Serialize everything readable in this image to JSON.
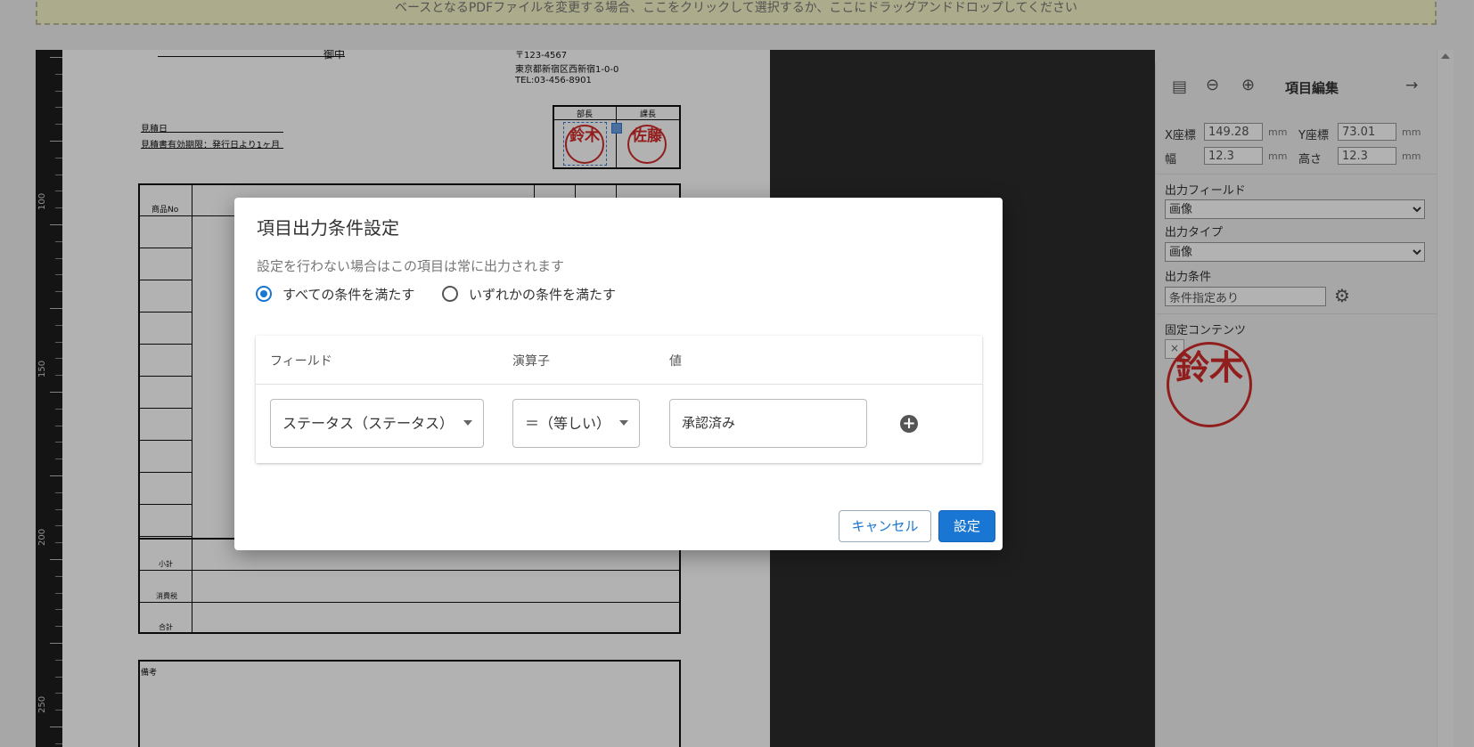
{
  "banner": {
    "text": "ベースとなるPDFファイルを変更する場合、ここをクリックして選択するか、ここにドラッグアンドドロップしてください"
  },
  "ruler": {
    "labels": [
      "100",
      "150",
      "200",
      "250"
    ]
  },
  "document": {
    "goten": "御中",
    "postal": "〒123-4567",
    "address": "東京都新宿区西新宿1-0-0",
    "tel": "TEL:03-456-8901",
    "estimate_date": "見積日",
    "validity": "見積書有効期限：発行日より1ヶ月",
    "approver1": "部長",
    "approver2": "課長",
    "stamp1": "鈴木",
    "stamp2": "佐藤",
    "col_item_no": "商品No",
    "subtotal": "小計",
    "tax": "消費税",
    "total": "合計",
    "remarks": "備考"
  },
  "panel": {
    "title": "項目編集",
    "x_label": "X座標",
    "x_value": "149.28",
    "y_label": "Y座標",
    "y_value": "73.01",
    "w_label": "幅",
    "w_value": "12.3",
    "h_label": "高さ",
    "h_value": "12.3",
    "unit": "mm",
    "field_label": "出力フィールド",
    "field_value": "画像",
    "type_label": "出力タイプ",
    "type_value": "画像",
    "cond_label": "出力条件",
    "cond_value": "条件指定あり",
    "fixed_label": "固定コンテンツ",
    "close_x": "×",
    "stamp_text": "鈴木"
  },
  "dialog": {
    "title": "項目出力条件設定",
    "hint": "設定を行わない場合はこの項目は常に出力されます",
    "radio_all": "すべての条件を満たす",
    "radio_any": "いずれかの条件を満たす",
    "col_field": "フィールド",
    "col_op": "演算子",
    "col_value": "値",
    "field_value": "ステータス（ステータス）",
    "op_value": "＝（等しい）",
    "value": "承認済み",
    "cancel": "キャンセル",
    "ok": "設定"
  }
}
